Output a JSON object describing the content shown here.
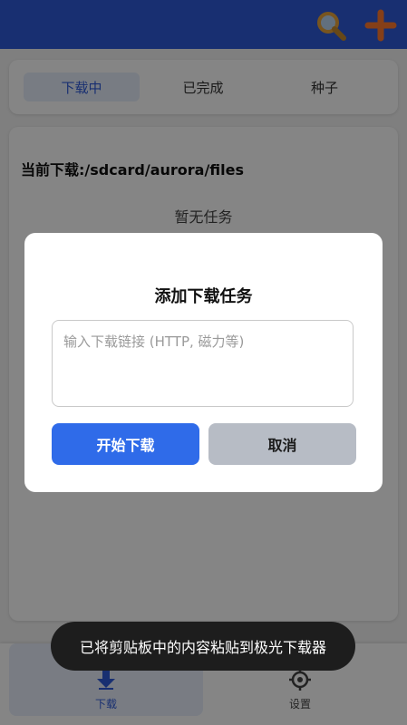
{
  "tabs": [
    {
      "label": "下载中",
      "active": true
    },
    {
      "label": "已完成",
      "active": false
    },
    {
      "label": "种子",
      "active": false
    }
  ],
  "content": {
    "current_path": "当前下载:/sdcard/aurora/files",
    "empty_text": "暂无任务"
  },
  "bottom_nav": {
    "download_label": "下载",
    "settings_label": "设置"
  },
  "dialog": {
    "title": "添加下载任务",
    "input_placeholder": "输入下载链接 (HTTP, 磁力等)",
    "input_value": "",
    "start_label": "开始下载",
    "cancel_label": "取消"
  },
  "toast": {
    "message": "已将剪贴板中的内容粘贴到极光下载器"
  },
  "colors": {
    "primary": "#2f5bd8",
    "start_button": "#2f6be9",
    "cancel_button": "#b7bcc5",
    "search_icon": "#f2b84b",
    "add_icon": "#ff7a2f"
  }
}
